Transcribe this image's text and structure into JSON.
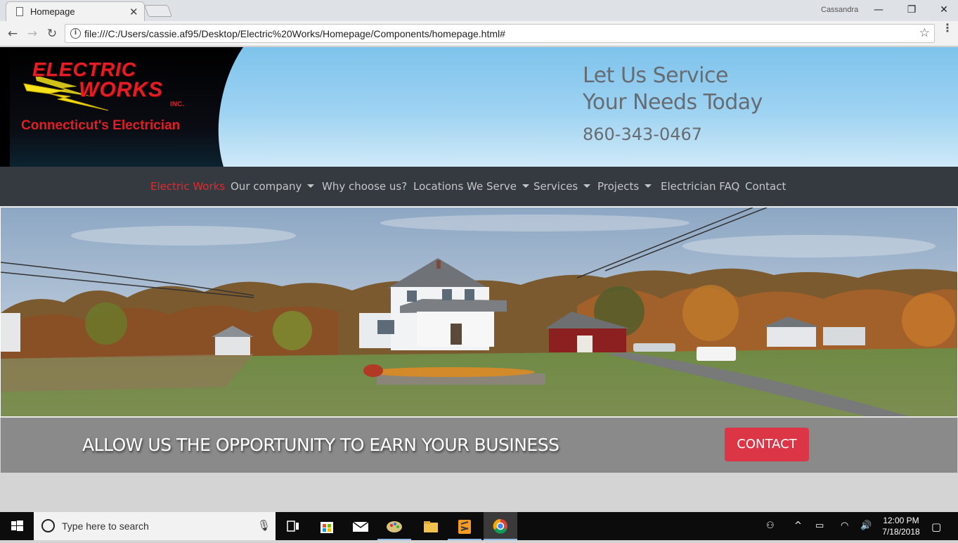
{
  "browser": {
    "tab_title": "Homepage",
    "tab_close": "✕",
    "profile_name": "Cassandra",
    "window_controls": {
      "minimize": "—",
      "restore": "❐",
      "close": "✕"
    },
    "back": "←",
    "forward": "→",
    "reload": "↻",
    "url": "file:///C:/Users/cassie.af95/Desktop/Electric%20Works/Homepage/Components/homepage.html#",
    "star": "☆",
    "menu": "⋮"
  },
  "logo": {
    "line1": "ELECTRIC",
    "line2": "WORKS",
    "inc": "INC.",
    "tagline": "Connecticut's Electrician"
  },
  "hero": {
    "headline_line1": "Let Us Service",
    "headline_line2": "Your Needs Today",
    "phone": "860-343-0467"
  },
  "navbar": {
    "brand": "Electric Works",
    "items": [
      {
        "label": "Our company",
        "dropdown": true
      },
      {
        "label": "Why choose us?",
        "dropdown": false
      },
      {
        "label": "Locations We Serve",
        "dropdown": true
      },
      {
        "label": "Services",
        "dropdown": true
      },
      {
        "label": "Projects",
        "dropdown": true
      },
      {
        "label": "Electrician FAQ",
        "dropdown": false
      },
      {
        "label": "Contact",
        "dropdown": false
      }
    ]
  },
  "cta": {
    "text": "ALLOW US THE OPPORTUNITY TO EARN YOUR BUSINESS",
    "button": "CONTACT"
  },
  "taskbar": {
    "search_placeholder": "Type here to search",
    "time": "12:00 PM",
    "date": "7/18/2018"
  },
  "colors": {
    "brand_red": "#e11d25",
    "navbar_bg": "#343a40",
    "cta_button": "#dc3545",
    "cta_band": "#8a8a8a"
  }
}
